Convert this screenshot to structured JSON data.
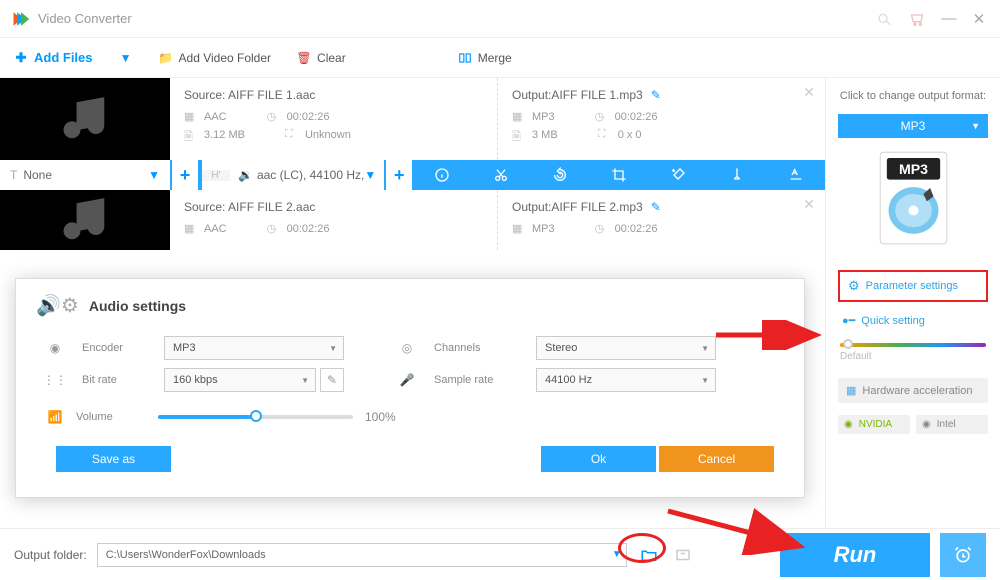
{
  "title": "Video Converter",
  "toolbar": {
    "add_files": "Add Files",
    "add_folder": "Add Video Folder",
    "clear": "Clear",
    "merge": "Merge"
  },
  "action_bar": {
    "watermark_select": "None",
    "audio_select": "aac (LC), 44100 Hz,"
  },
  "files": [
    {
      "source_name": "Source: AIFF FILE 1.aac",
      "source_codec": "AAC",
      "source_duration": "00:02:26",
      "source_size": "3.12 MB",
      "source_dim": "Unknown",
      "output_name": "Output:AIFF FILE 1.mp3",
      "output_codec": "MP3",
      "output_duration": "00:02:26",
      "output_size": "3 MB",
      "output_dim": "0 x 0"
    },
    {
      "source_name": "Source: AIFF FILE 2.aac",
      "source_codec": "AAC",
      "source_duration": "00:02:26",
      "output_name": "Output:AIFF FILE 2.mp3",
      "output_codec": "MP3",
      "output_duration": "00:02:26"
    }
  ],
  "dialog": {
    "title": "Audio settings",
    "encoder_label": "Encoder",
    "encoder_value": "MP3",
    "bitrate_label": "Bit rate",
    "bitrate_value": "160 kbps",
    "channels_label": "Channels",
    "channels_value": "Stereo",
    "samplerate_label": "Sample rate",
    "samplerate_value": "44100 Hz",
    "volume_label": "Volume",
    "volume_value": "100%",
    "save_label": "Save as",
    "ok_label": "Ok",
    "cancel_label": "Cancel"
  },
  "side": {
    "header": "Click to change output format:",
    "format": "MP3",
    "format_badge": "MP3",
    "param_settings": "Parameter settings",
    "quick_setting": "Quick setting",
    "slider_label": "Default",
    "hw_accel": "Hardware acceleration",
    "nvidia": "NVIDIA",
    "intel": "Intel"
  },
  "bottom": {
    "folder_label": "Output folder:",
    "folder_path": "C:\\Users\\WonderFox\\Downloads",
    "run": "Run"
  }
}
